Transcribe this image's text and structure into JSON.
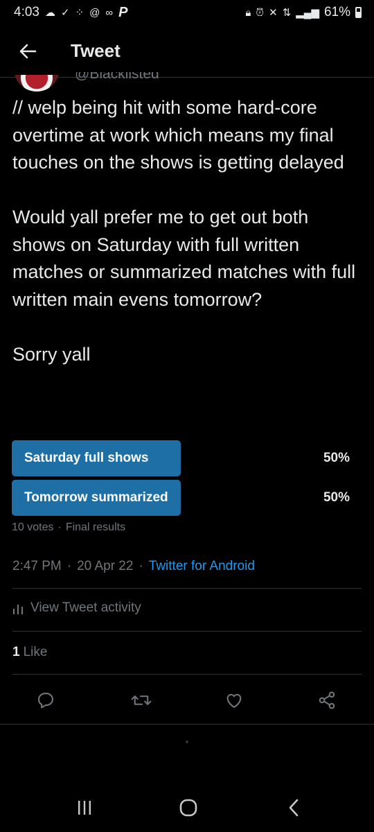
{
  "status_bar": {
    "time": "4:03",
    "battery": "61%",
    "icons": [
      "cloud-icon",
      "signal-check-icon",
      "dots-icon",
      "at-icon",
      "voicemail-icon",
      "p-logo-icon",
      "lock-icon",
      "alarm-icon",
      "mute-icon",
      "wifi-icon",
      "cell-signal-icon",
      "battery-icon"
    ]
  },
  "header": {
    "title": "Tweet",
    "back_icon": "arrow-left-icon"
  },
  "tweet": {
    "handle_partial": "@Blacklisted",
    "paragraphs": [
      "// welp being hit with some hard-core overtime at work which means my final touches on the shows is getting delayed",
      "Would yall prefer me to get out both shows on Saturday with full written matches or summarized matches with full written main evens tomorrow?",
      "Sorry yall"
    ]
  },
  "poll": {
    "options": [
      {
        "label": "Saturday full shows",
        "percent_text": "50%",
        "share": 50
      },
      {
        "label": "Tomorrow summarized",
        "percent_text": "50%",
        "share": 50
      }
    ],
    "votes": "10 votes",
    "separator": "·",
    "status": "Final results",
    "bar_color": "#1d6fa6"
  },
  "meta": {
    "time": "2:47 PM",
    "sep1": "·",
    "date": "20 Apr 22",
    "sep2": "·",
    "source": "Twitter for Android"
  },
  "activity": {
    "label": "View Tweet activity",
    "icon": "bar-chart-icon"
  },
  "likes": {
    "count": "1",
    "label": "Like"
  },
  "actions": [
    {
      "name": "reply",
      "icon": "reply-icon"
    },
    {
      "name": "retweet",
      "icon": "retweet-icon"
    },
    {
      "name": "like",
      "icon": "heart-icon"
    },
    {
      "name": "share",
      "icon": "share-icon"
    }
  ],
  "colors": {
    "background": "#000000",
    "text": "#e7e9ea",
    "muted": "#71767b",
    "accent": "#1d9bf0",
    "divider": "#2f3336"
  },
  "system_nav": [
    "recents-icon",
    "home-icon",
    "back-icon"
  ]
}
